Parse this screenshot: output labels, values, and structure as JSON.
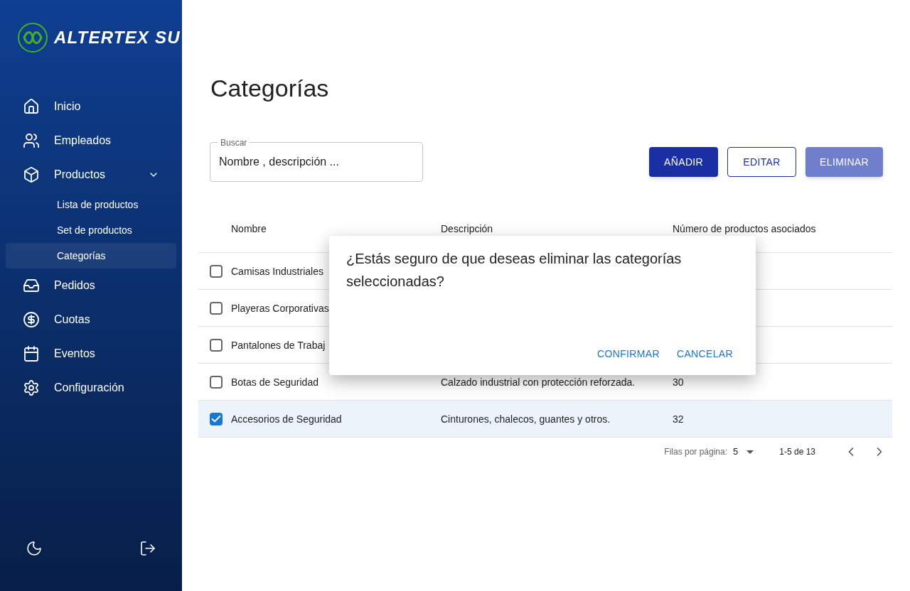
{
  "logo": {
    "text": "ALTERTEX SU"
  },
  "sidebar": {
    "items": [
      {
        "label": "Inicio",
        "selected": false
      },
      {
        "label": "Empleados",
        "selected": false
      },
      {
        "label": "Productos",
        "selected": false,
        "expanded": true,
        "children": [
          {
            "label": "Lista de productos",
            "selected": false
          },
          {
            "label": "Set de productos",
            "selected": false
          },
          {
            "label": "Categorías",
            "selected": true
          }
        ]
      },
      {
        "label": "Pedidos",
        "selected": false
      },
      {
        "label": "Cuotas",
        "selected": false
      },
      {
        "label": "Eventos",
        "selected": false
      },
      {
        "label": "Configuración",
        "selected": false
      }
    ]
  },
  "page_title": "Categorías",
  "search": {
    "label": "Buscar",
    "placeholder": "Nombre , descripción ..."
  },
  "buttons": [
    {
      "label": "AÑADIR",
      "kind": "primary"
    },
    {
      "label": "EDITAR",
      "kind": "outlined"
    },
    {
      "label": "ELIMINAR",
      "kind": "disabled"
    }
  ],
  "table": {
    "columns": [
      "Nombre",
      "Descripción",
      "Número de productos asociados"
    ],
    "rows": [
      {
        "selected": false,
        "name": "Camisas Industriales"
      },
      {
        "selected": false,
        "name": "Playeras Corporativas"
      },
      {
        "selected": false,
        "name": "Pantalones de Trabaj"
      },
      {
        "selected": false,
        "name": "Botas de Seguridad",
        "description": "Calzado industrial con protección reforzada.",
        "count": "30"
      },
      {
        "selected": true,
        "name": "Accesorios de Seguridad",
        "description": "Cinturones, chalecos, guantes y otros.",
        "count": "32"
      }
    ]
  },
  "pagination": {
    "rows_label": "Filas por página:",
    "rows_value": "5",
    "range": "1-5 de 13"
  },
  "dialog": {
    "message": "¿Estás seguro de que deseas eliminar las categorías seleccionadas?",
    "buttons": [
      "CONFIRMAR",
      "CANCELAR"
    ]
  }
}
